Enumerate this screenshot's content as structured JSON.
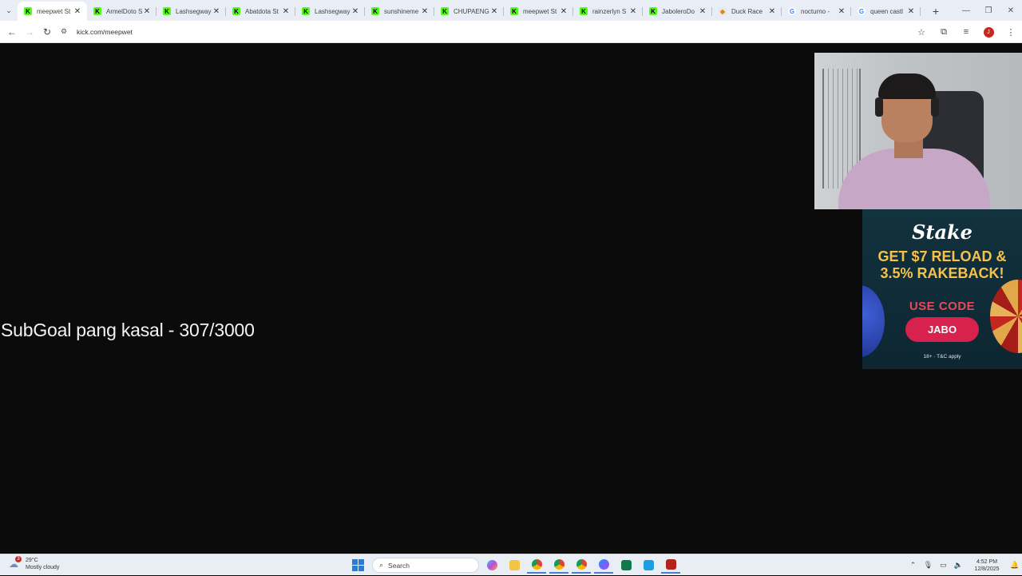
{
  "browser": {
    "tabs": [
      {
        "label": "meepwet St",
        "icon": "kick-favicon",
        "active": true
      },
      {
        "label": "ArmelDoto S",
        "icon": "kick-favicon"
      },
      {
        "label": "Lashsegway",
        "icon": "kick-favicon"
      },
      {
        "label": "Abatdota St",
        "icon": "kick-favicon"
      },
      {
        "label": "Lashsegway",
        "icon": "kick-favicon"
      },
      {
        "label": "sunshineme",
        "icon": "kick-favicon"
      },
      {
        "label": "CHUPAENG",
        "icon": "kick-favicon"
      },
      {
        "label": "meepwet St",
        "icon": "kick-favicon"
      },
      {
        "label": "rainzerlyn S",
        "icon": "kick-favicon"
      },
      {
        "label": "JaboleroDo",
        "icon": "kick-favicon"
      },
      {
        "label": "Duck Race",
        "icon": "duck-favicon"
      },
      {
        "label": "nocturno -",
        "icon": "google-favicon"
      },
      {
        "label": "queen castl",
        "icon": "google-favicon"
      }
    ],
    "url": "kick.com/meepwet",
    "profile_initial": "J"
  },
  "stream": {
    "overlay_text": "SubGoal pang kasal - 307/3000",
    "sub_goal": {
      "current": 307,
      "target": 3000
    }
  },
  "ad": {
    "brand": "Stake",
    "headline_line1": "GET $7 RELOAD &",
    "headline_line2": "3.5% RAKEBACK!",
    "use_code_label": "USE CODE",
    "code": "JABO",
    "terms": "18+ · T&C apply",
    "colors": {
      "background": "#12323e",
      "headline": "#f6c24c",
      "use_code": "#e8495a",
      "button": "#d8224e"
    }
  },
  "taskbar": {
    "weather_temp": "29°C",
    "weather_desc": "Mostly cloudy",
    "weather_badge": "3",
    "search_placeholder": "Search",
    "time": "4:52 PM",
    "date": "12/8/2025"
  }
}
